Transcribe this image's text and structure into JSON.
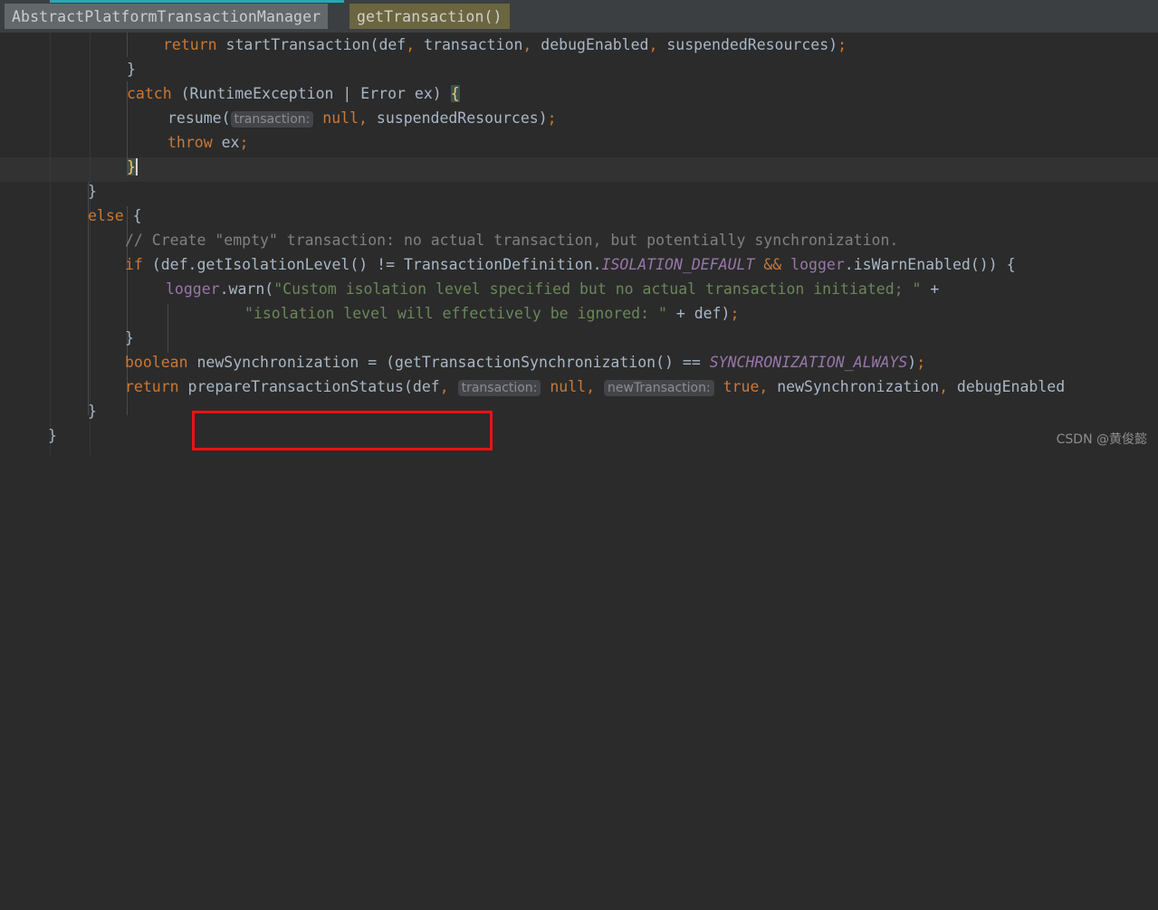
{
  "breadcrumb": {
    "class_name": "AbstractPlatformTransactionManager",
    "method_name": "getTransaction()"
  },
  "editor": {
    "theme_background": "#2b2b2b",
    "gutter_background": "#313335",
    "current_line_background": "#323232",
    "accent_tab_color": "#2aa5b8",
    "annotation_color": "#ee1111",
    "lines": [
      {
        "id": "line-1",
        "indent": 180,
        "text": "return startTransaction(def, transaction, debugEnabled, suspendedResources);"
      },
      {
        "id": "line-2",
        "indent": 140,
        "text": "}"
      },
      {
        "id": "line-3",
        "indent": 140,
        "text": "catch (RuntimeException | Error ex) {"
      },
      {
        "id": "line-4",
        "indent": 185,
        "text": "resume( transaction: null, suspendedResources);"
      },
      {
        "id": "line-5",
        "indent": 185,
        "text": "throw ex;"
      },
      {
        "id": "line-6",
        "indent": 140,
        "text": "}"
      },
      {
        "id": "line-7",
        "indent": 97,
        "text": "}"
      },
      {
        "id": "line-8",
        "indent": 97,
        "text": "else {"
      },
      {
        "id": "line-9",
        "indent": 138,
        "text": "// Create \"empty\" transaction: no actual transaction, but potentially synchronization."
      },
      {
        "id": "line-10",
        "indent": 138,
        "text": "if (def.getIsolationLevel() != TransactionDefinition.ISOLATION_DEFAULT && logger.isWarnEnabled()) {"
      },
      {
        "id": "line-11",
        "indent": 183,
        "text": "logger.warn(\"Custom isolation level specified but no actual transaction initiated; \" +"
      },
      {
        "id": "line-12",
        "indent": 270,
        "text": "\"isolation level will effectively be ignored: \" + def);"
      },
      {
        "id": "line-13",
        "indent": 138,
        "text": "}"
      },
      {
        "id": "line-14",
        "indent": 138,
        "text": "boolean newSynchronization = (getTransactionSynchronization() == SYNCHRONIZATION_ALWAYS);"
      },
      {
        "id": "line-15",
        "indent": 138,
        "text": "return prepareTransactionStatus(def, transaction: null, newTransaction: true, newSynchronization, debugEnabled"
      },
      {
        "id": "line-16",
        "indent": 97,
        "text": "}"
      },
      {
        "id": "line-17",
        "indent": 53,
        "text": "}"
      }
    ],
    "parameter_hints": [
      {
        "label": "transaction:",
        "line": "line-4"
      },
      {
        "label": "transaction:",
        "line": "line-15"
      },
      {
        "label": "newTransaction:",
        "line": "line-15"
      }
    ],
    "tokens": {
      "kw_return": "return",
      "kw_catch": "catch",
      "kw_throw": "throw",
      "kw_else": "else",
      "kw_if": "if",
      "kw_boolean": "boolean",
      "kw_null": "null",
      "kw_true": "true",
      "method_start_transaction": "startTransaction",
      "method_resume": "resume",
      "method_prepare": "prepareTransactionStatus",
      "const_isolation_default": "ISOLATION_DEFAULT",
      "const_synchronization_always": "SYNCHRONIZATION_ALWAYS",
      "field_logger": "logger",
      "string_1": "\"Custom isolation level specified but no actual transaction initiated; \"",
      "string_2": "\"isolation level will effectively be ignored: \"",
      "comment_1": "// Create \"empty\" transaction: no actual transaction, but potentially synchronization."
    }
  },
  "watermark": {
    "text": "CSDN @黄俊懿"
  }
}
